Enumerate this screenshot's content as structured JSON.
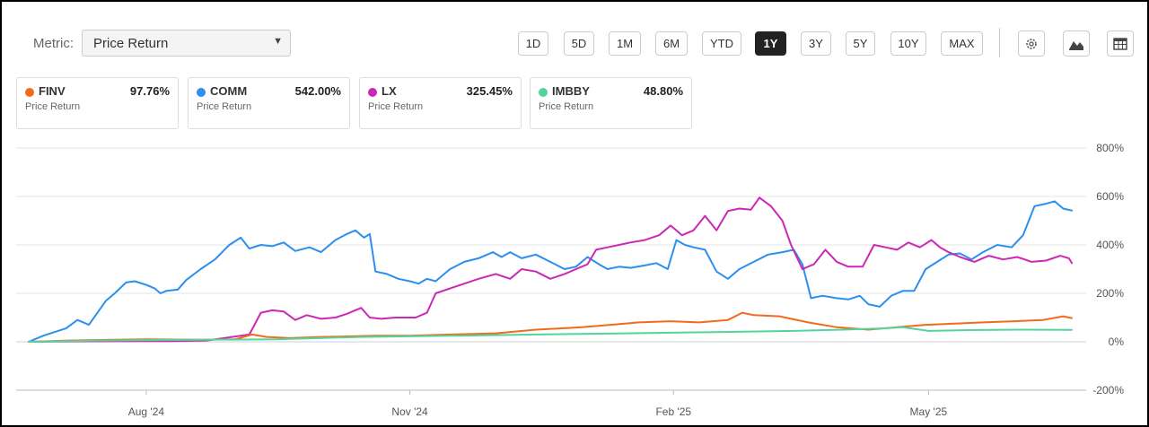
{
  "metric": {
    "label": "Metric:",
    "selected": "Price Return"
  },
  "ranges": [
    "1D",
    "5D",
    "1M",
    "6M",
    "YTD",
    "1Y",
    "3Y",
    "5Y",
    "10Y",
    "MAX"
  ],
  "active_range": "1Y",
  "tools": [
    "gear-icon",
    "mountain-chart-icon",
    "table-icon"
  ],
  "cards": [
    {
      "ticker": "FINV",
      "value": "97.76%",
      "metric": "Price Return",
      "color": "#f26b1d"
    },
    {
      "ticker": "COMM",
      "value": "542.00%",
      "metric": "Price Return",
      "color": "#2b8ff0"
    },
    {
      "ticker": "LX",
      "value": "325.45%",
      "metric": "Price Return",
      "color": "#cc28b4"
    },
    {
      "ticker": "IMBBY",
      "value": "48.80%",
      "metric": "Price Return",
      "color": "#52d49a"
    }
  ],
  "chart_data": {
    "type": "line",
    "xlabel": "",
    "ylabel": "",
    "ylim": [
      -200,
      800
    ],
    "yticks": [
      800,
      600,
      400,
      200,
      0,
      -200
    ],
    "ytick_labels": [
      "800%",
      "600%",
      "400%",
      "200%",
      "0%",
      "-200%"
    ],
    "xlim": [
      "2024-06-21",
      "2025-06-20"
    ],
    "xticks": [
      {
        "date": "2024-08-01",
        "label": "Aug '24"
      },
      {
        "date": "2024-11-01",
        "label": "Nov '24"
      },
      {
        "date": "2025-02-01",
        "label": "Feb '25"
      },
      {
        "date": "2025-05-01",
        "label": "May '25"
      }
    ],
    "grid": true,
    "series": [
      {
        "name": "COMM",
        "color": "#2b8ff0",
        "points": [
          [
            "2024-06-21",
            0
          ],
          [
            "2024-06-26",
            25
          ],
          [
            "2024-06-30",
            40
          ],
          [
            "2024-07-04",
            55
          ],
          [
            "2024-07-08",
            90
          ],
          [
            "2024-07-12",
            70
          ],
          [
            "2024-07-15",
            120
          ],
          [
            "2024-07-18",
            170
          ],
          [
            "2024-07-21",
            200
          ],
          [
            "2024-07-25",
            245
          ],
          [
            "2024-07-28",
            250
          ],
          [
            "2024-08-01",
            235
          ],
          [
            "2024-08-04",
            220
          ],
          [
            "2024-08-06",
            200
          ],
          [
            "2024-08-08",
            210
          ],
          [
            "2024-08-12",
            215
          ],
          [
            "2024-08-15",
            255
          ],
          [
            "2024-08-20",
            300
          ],
          [
            "2024-08-25",
            340
          ],
          [
            "2024-08-30",
            400
          ],
          [
            "2024-09-03",
            430
          ],
          [
            "2024-09-06",
            385
          ],
          [
            "2024-09-10",
            400
          ],
          [
            "2024-09-14",
            395
          ],
          [
            "2024-09-18",
            410
          ],
          [
            "2024-09-22",
            375
          ],
          [
            "2024-09-27",
            390
          ],
          [
            "2024-10-01",
            370
          ],
          [
            "2024-10-06",
            420
          ],
          [
            "2024-10-10",
            445
          ],
          [
            "2024-10-13",
            460
          ],
          [
            "2024-10-16",
            430
          ],
          [
            "2024-10-18",
            445
          ],
          [
            "2024-10-20",
            290
          ],
          [
            "2024-10-24",
            280
          ],
          [
            "2024-10-28",
            260
          ],
          [
            "2024-11-01",
            250
          ],
          [
            "2024-11-04",
            240
          ],
          [
            "2024-11-07",
            260
          ],
          [
            "2024-11-10",
            250
          ],
          [
            "2024-11-15",
            300
          ],
          [
            "2024-11-20",
            330
          ],
          [
            "2024-11-25",
            345
          ],
          [
            "2024-11-30",
            370
          ],
          [
            "2024-12-03",
            350
          ],
          [
            "2024-12-06",
            370
          ],
          [
            "2024-12-10",
            345
          ],
          [
            "2024-12-15",
            360
          ],
          [
            "2024-12-20",
            330
          ],
          [
            "2024-12-25",
            300
          ],
          [
            "2024-12-29",
            310
          ],
          [
            "2025-01-02",
            350
          ],
          [
            "2025-01-06",
            320
          ],
          [
            "2025-01-09",
            300
          ],
          [
            "2025-01-13",
            310
          ],
          [
            "2025-01-17",
            305
          ],
          [
            "2025-01-22",
            315
          ],
          [
            "2025-01-26",
            325
          ],
          [
            "2025-01-30",
            300
          ],
          [
            "2025-02-02",
            420
          ],
          [
            "2025-02-05",
            400
          ],
          [
            "2025-02-08",
            390
          ],
          [
            "2025-02-12",
            380
          ],
          [
            "2025-02-16",
            290
          ],
          [
            "2025-02-20",
            260
          ],
          [
            "2025-02-24",
            300
          ],
          [
            "2025-03-01",
            330
          ],
          [
            "2025-03-06",
            360
          ],
          [
            "2025-03-11",
            370
          ],
          [
            "2025-03-15",
            380
          ],
          [
            "2025-03-18",
            320
          ],
          [
            "2025-03-21",
            180
          ],
          [
            "2025-03-25",
            190
          ],
          [
            "2025-03-30",
            180
          ],
          [
            "2025-04-03",
            175
          ],
          [
            "2025-04-07",
            190
          ],
          [
            "2025-04-10",
            155
          ],
          [
            "2025-04-14",
            145
          ],
          [
            "2025-04-18",
            190
          ],
          [
            "2025-04-22",
            210
          ],
          [
            "2025-04-26",
            210
          ],
          [
            "2025-04-30",
            300
          ],
          [
            "2025-05-04",
            330
          ],
          [
            "2025-05-08",
            360
          ],
          [
            "2025-05-12",
            365
          ],
          [
            "2025-05-16",
            340
          ],
          [
            "2025-05-20",
            370
          ],
          [
            "2025-05-25",
            400
          ],
          [
            "2025-05-30",
            390
          ],
          [
            "2025-06-03",
            440
          ],
          [
            "2025-06-07",
            560
          ],
          [
            "2025-06-11",
            570
          ],
          [
            "2025-06-14",
            580
          ],
          [
            "2025-06-17",
            550
          ],
          [
            "2025-06-20",
            542
          ]
        ]
      },
      {
        "name": "LX",
        "color": "#cc28b4",
        "points": [
          [
            "2024-06-21",
            0
          ],
          [
            "2024-07-10",
            2
          ],
          [
            "2024-08-10",
            3
          ],
          [
            "2024-08-22",
            5
          ],
          [
            "2024-09-06",
            30
          ],
          [
            "2024-09-10",
            120
          ],
          [
            "2024-09-14",
            130
          ],
          [
            "2024-09-18",
            125
          ],
          [
            "2024-09-22",
            90
          ],
          [
            "2024-09-26",
            110
          ],
          [
            "2024-10-01",
            95
          ],
          [
            "2024-10-06",
            100
          ],
          [
            "2024-10-10",
            115
          ],
          [
            "2024-10-15",
            140
          ],
          [
            "2024-10-18",
            100
          ],
          [
            "2024-10-22",
            95
          ],
          [
            "2024-10-27",
            100
          ],
          [
            "2024-11-03",
            100
          ],
          [
            "2024-11-07",
            120
          ],
          [
            "2024-11-10",
            200
          ],
          [
            "2024-11-15",
            220
          ],
          [
            "2024-11-20",
            240
          ],
          [
            "2024-11-25",
            260
          ],
          [
            "2024-12-01",
            280
          ],
          [
            "2024-12-06",
            260
          ],
          [
            "2024-12-10",
            300
          ],
          [
            "2024-12-15",
            290
          ],
          [
            "2024-12-20",
            260
          ],
          [
            "2024-12-25",
            280
          ],
          [
            "2024-12-29",
            300
          ],
          [
            "2025-01-02",
            320
          ],
          [
            "2025-01-05",
            380
          ],
          [
            "2025-01-09",
            390
          ],
          [
            "2025-01-13",
            400
          ],
          [
            "2025-01-17",
            410
          ],
          [
            "2025-01-22",
            420
          ],
          [
            "2025-01-27",
            440
          ],
          [
            "2025-01-31",
            480
          ],
          [
            "2025-02-04",
            440
          ],
          [
            "2025-02-08",
            460
          ],
          [
            "2025-02-12",
            520
          ],
          [
            "2025-02-16",
            460
          ],
          [
            "2025-02-20",
            540
          ],
          [
            "2025-02-24",
            550
          ],
          [
            "2025-02-28",
            545
          ],
          [
            "2025-03-03",
            595
          ],
          [
            "2025-03-07",
            560
          ],
          [
            "2025-03-11",
            500
          ],
          [
            "2025-03-14",
            400
          ],
          [
            "2025-03-18",
            300
          ],
          [
            "2025-03-22",
            320
          ],
          [
            "2025-03-26",
            380
          ],
          [
            "2025-03-30",
            330
          ],
          [
            "2025-04-03",
            310
          ],
          [
            "2025-04-08",
            310
          ],
          [
            "2025-04-12",
            400
          ],
          [
            "2025-04-16",
            390
          ],
          [
            "2025-04-20",
            380
          ],
          [
            "2025-04-24",
            410
          ],
          [
            "2025-04-28",
            390
          ],
          [
            "2025-05-02",
            420
          ],
          [
            "2025-05-05",
            390
          ],
          [
            "2025-05-08",
            370
          ],
          [
            "2025-05-12",
            350
          ],
          [
            "2025-05-17",
            330
          ],
          [
            "2025-05-22",
            355
          ],
          [
            "2025-05-27",
            340
          ],
          [
            "2025-06-01",
            350
          ],
          [
            "2025-06-06",
            330
          ],
          [
            "2025-06-11",
            335
          ],
          [
            "2025-06-16",
            355
          ],
          [
            "2025-06-19",
            345
          ],
          [
            "2025-06-20",
            325
          ]
        ]
      },
      {
        "name": "FINV",
        "color": "#f26b1d",
        "points": [
          [
            "2024-06-21",
            0
          ],
          [
            "2024-07-05",
            5
          ],
          [
            "2024-07-20",
            8
          ],
          [
            "2024-08-01",
            10
          ],
          [
            "2024-08-20",
            8
          ],
          [
            "2024-09-01",
            10
          ],
          [
            "2024-09-07",
            30
          ],
          [
            "2024-09-12",
            20
          ],
          [
            "2024-09-20",
            15
          ],
          [
            "2024-10-01",
            20
          ],
          [
            "2024-10-20",
            25
          ],
          [
            "2024-11-01",
            25
          ],
          [
            "2024-11-15",
            30
          ],
          [
            "2024-12-01",
            35
          ],
          [
            "2024-12-15",
            50
          ],
          [
            "2024-12-31",
            60
          ],
          [
            "2025-01-10",
            70
          ],
          [
            "2025-01-20",
            80
          ],
          [
            "2025-01-31",
            85
          ],
          [
            "2025-02-10",
            80
          ],
          [
            "2025-02-20",
            90
          ],
          [
            "2025-02-25",
            120
          ],
          [
            "2025-03-01",
            110
          ],
          [
            "2025-03-10",
            105
          ],
          [
            "2025-03-20",
            80
          ],
          [
            "2025-03-30",
            60
          ],
          [
            "2025-04-10",
            50
          ],
          [
            "2025-04-20",
            60
          ],
          [
            "2025-04-30",
            70
          ],
          [
            "2025-05-10",
            75
          ],
          [
            "2025-05-20",
            80
          ],
          [
            "2025-05-31",
            85
          ],
          [
            "2025-06-10",
            90
          ],
          [
            "2025-06-17",
            105
          ],
          [
            "2025-06-20",
            97.76
          ]
        ]
      },
      {
        "name": "IMBBY",
        "color": "#52d49a",
        "points": [
          [
            "2024-06-21",
            0
          ],
          [
            "2024-07-15",
            5
          ],
          [
            "2024-08-15",
            8
          ],
          [
            "2024-09-15",
            10
          ],
          [
            "2024-10-15",
            20
          ],
          [
            "2024-11-15",
            25
          ],
          [
            "2024-12-15",
            30
          ],
          [
            "2025-01-15",
            35
          ],
          [
            "2025-02-15",
            40
          ],
          [
            "2025-03-15",
            45
          ],
          [
            "2025-04-01",
            50
          ],
          [
            "2025-04-15",
            55
          ],
          [
            "2025-04-22",
            60
          ],
          [
            "2025-05-01",
            45
          ],
          [
            "2025-05-15",
            48
          ],
          [
            "2025-06-01",
            50
          ],
          [
            "2025-06-20",
            48.8
          ]
        ]
      }
    ]
  }
}
